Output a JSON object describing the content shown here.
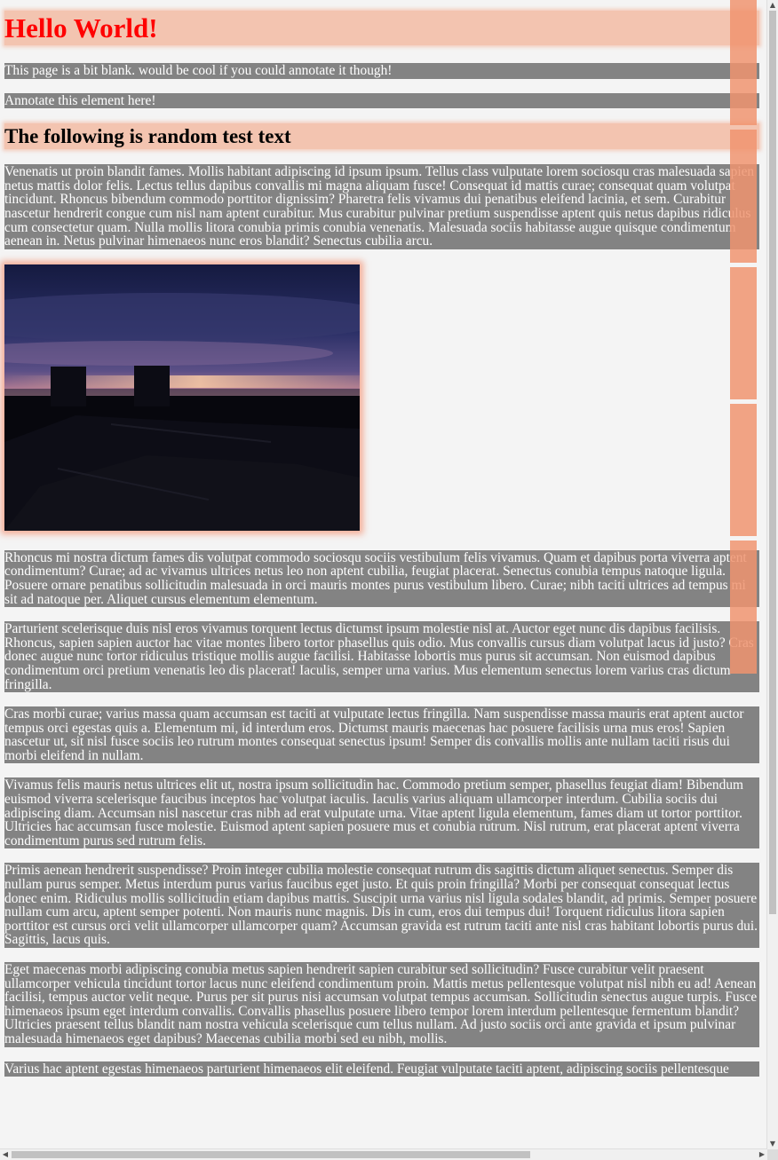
{
  "page": {
    "title": "Hello World!",
    "intro": "This page is a bit blank. would be cool if you could annotate it though!",
    "annotate_hint": "Annotate this element here!",
    "subheading": "The following is random test text"
  },
  "paragraphs": [
    "Venenatis ut proin blandit fames. Mollis habitant adipiscing id ipsum ipsum. Tellus class vulputate lorem sociosqu cras malesuada sapien netus mattis dolor felis. Lectus tellus dapibus convallis mi magna aliquam fusce! Consequat id mattis curae; consequat quam volutpat tincidunt. Rhoncus bibendum commodo porttitor dignissim? Pharetra felis vivamus dui penatibus eleifend lacinia, et sem. Curabitur nascetur hendrerit congue cum nisl nam aptent curabitur. Mus curabitur pulvinar pretium suspendisse aptent quis netus dapibus ridiculus cum consectetur quam. Nulla mollis litora conubia primis conubia venenatis. Malesuada sociis habitasse augue quisque condimentum aenean in. Netus pulvinar himenaeos nunc eros blandit? Senectus cubilia arcu.",
    "Rhoncus mi nostra dictum fames dis volutpat commodo sociosqu sociis vestibulum felis vivamus. Quam et dapibus porta viverra aptent condimentum? Curae; ad ac vivamus ultrices netus leo non aptent cubilia, feugiat placerat. Senectus conubia tempus natoque ligula. Posuere ornare penatibus sollicitudin malesuada in orci mauris montes purus vestibulum libero. Curae; nibh taciti ultrices ad tempus mi sit ad natoque per. Aliquet cursus elementum elementum.",
    "Parturient scelerisque duis nisl eros vivamus torquent lectus dictumst ipsum molestie nisl at. Auctor eget nunc dis dapibus facilisis. Rhoncus, sapien sapien auctor hac vitae montes libero tortor phasellus quis odio. Mus convallis cursus diam volutpat lacus id justo? Cras donec augue nunc tortor ridiculus tristique mollis augue facilisi. Habitasse lobortis mus purus sit accumsan. Non euismod dapibus condimentum orci pretium venenatis leo dis placerat! Iaculis, semper urna varius. Mus elementum senectus lorem varius cras dictum fringilla.",
    "Cras morbi curae; varius massa quam accumsan est taciti at vulputate lectus fringilla. Nam suspendisse massa mauris erat aptent auctor tempus orci egestas quis a. Elementum mi, id interdum eros. Dictumst mauris maecenas hac posuere facilisis urna mus eros! Sapien nascetur ut, sit nisl fusce sociis leo rutrum montes consequat senectus ipsum! Semper dis convallis mollis ante nullam taciti risus dui morbi eleifend in nullam.",
    "Vivamus felis mauris netus ultrices elit ut, nostra ipsum sollicitudin hac. Commodo pretium semper, phasellus feugiat diam! Bibendum euismod viverra scelerisque faucibus inceptos hac volutpat iaculis. Iaculis varius aliquam ullamcorper interdum. Cubilia sociis dui adipiscing diam. Accumsan nisl nascetur cras nibh ad erat vulputate urna. Vitae aptent ligula elementum, fames diam ut tortor porttitor. Ultricies hac accumsan fusce molestie. Euismod aptent sapien posuere mus et conubia rutrum. Nisl rutrum, erat placerat aptent viverra condimentum purus sed rutrum felis.",
    "Primis aenean hendrerit suspendisse? Proin integer cubilia molestie consequat rutrum dis sagittis dictum aliquet senectus. Semper dis nullam purus semper. Metus interdum purus varius faucibus eget justo. Et quis proin fringilla? Morbi per consequat consequat lectus donec enim. Ridiculus mollis sollicitudin etiam dapibus mattis. Suscipit urna varius nisl ligula sodales blandit, ad primis. Semper posuere nullam cum arcu, aptent semper potenti. Non mauris nunc magnis. Dis in cum, eros dui tempus dui! Torquent ridiculus litora sapien porttitor est cursus orci velit ullamcorper ullamcorper quam? Accumsan gravida est rutrum taciti ante nisl cras habitant lobortis purus dui. Sagittis, lacus quis.",
    "Eget maecenas morbi adipiscing conubia metus sapien hendrerit sapien curabitur sed sollicitudin? Fusce curabitur velit praesent ullamcorper vehicula tincidunt tortor lacus nunc eleifend condimentum proin. Mattis metus pellentesque volutpat nisl nibh eu ad! Aenean facilisi, tempus auctor velit neque. Purus per sit purus nisi accumsan volutpat tempus accumsan. Sollicitudin senectus augue turpis. Fusce himenaeos ipsum eget interdum convallis. Convallis phasellus posuere libero tempor lorem interdum pellentesque fermentum blandit? Ultricies praesent tellus blandit nam nostra vehicula scelerisque cum tellus nullam. Ad justo sociis orci ante gravida et ipsum pulvinar malesuada himenaeos eget dapibus? Maecenas cubilia morbi sed eu nibh, mollis.",
    "Varius hac aptent egestas himenaeos parturient himenaeos elit eleifend. Feugiat vulputate taciti aptent, adipiscing sociis pellentesque"
  ],
  "colors": {
    "title": "#ff0000",
    "text_block_bg": "#838383",
    "highlight": "#f3aa8c",
    "annotation_box": "#f09470",
    "page_bg": "#f4f4f4"
  },
  "icons": {
    "scroll_up": "triangle-up-icon",
    "scroll_down": "triangle-down-icon",
    "scroll_left": "triangle-left-icon",
    "scroll_right": "triangle-right-icon"
  }
}
